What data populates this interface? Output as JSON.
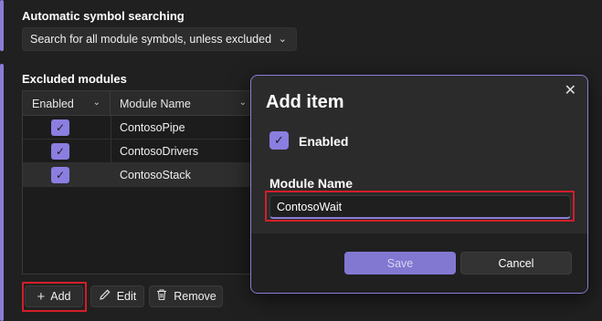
{
  "symbol_search": {
    "title": "Automatic symbol searching",
    "selected": "Search for all module symbols, unless excluded",
    "chevron": "⌄"
  },
  "excluded": {
    "title": "Excluded modules",
    "columns": [
      "Enabled",
      "Module Name"
    ],
    "rows": [
      {
        "enabled": true,
        "name": "ContosoPipe"
      },
      {
        "enabled": true,
        "name": "ContosoDrivers"
      },
      {
        "enabled": true,
        "name": "ContosoStack"
      }
    ]
  },
  "toolbar": {
    "add_label": "Add",
    "edit_label": "Edit",
    "remove_label": "Remove",
    "add_icon": "plus-icon",
    "edit_icon": "pencil-icon",
    "remove_icon": "trash-icon"
  },
  "dialog": {
    "title": "Add item",
    "enabled_label": "Enabled",
    "enabled_checked": true,
    "module_name_label": "Module Name",
    "module_name_value": "ContosoWait",
    "save_label": "Save",
    "cancel_label": "Cancel",
    "close_icon": "close-icon"
  },
  "colors": {
    "accent": "#8a7dd8",
    "highlight": "#d11f2a",
    "background": "#202020"
  }
}
